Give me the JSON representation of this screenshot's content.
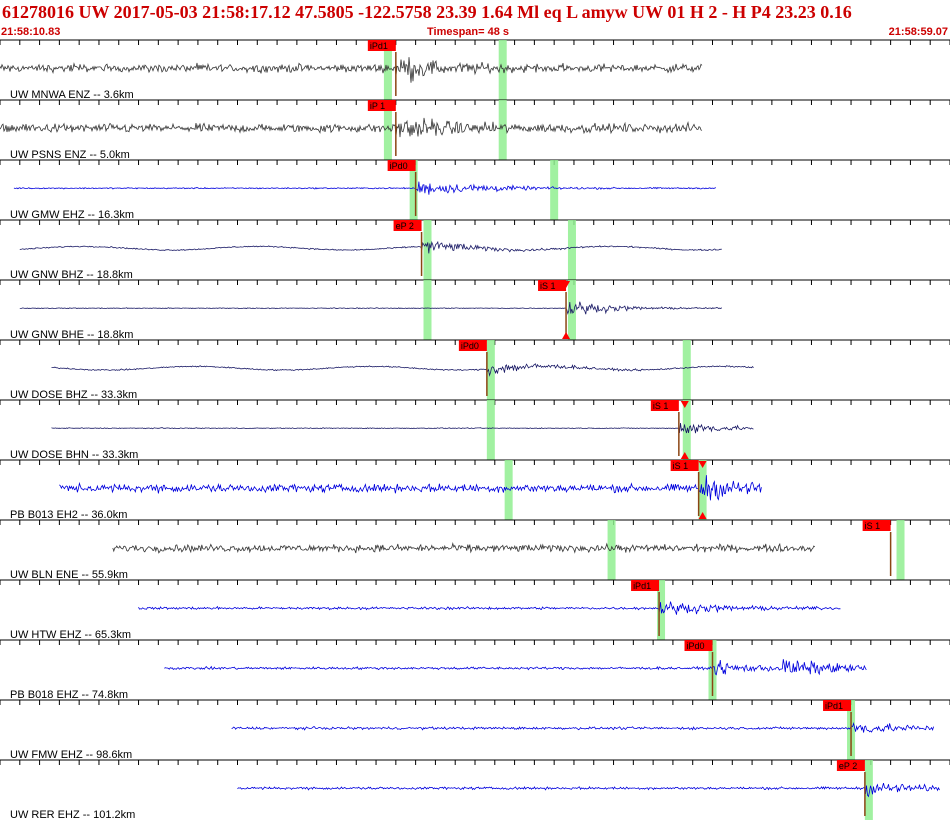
{
  "header": {
    "title": "61278016 UW 2017-05-03 21:58:17.12   47.5805 -122.5758  23.39  1.64 Ml  eq  L amyw     UW 01  H   2  - H P4   23.23  0.16",
    "start_time": "21:58:10.83",
    "timespan": "Timespan=  48 s",
    "end_time": "21:58:59.07"
  },
  "colors": {
    "background": "#ffffff",
    "title_text": "#cc0000",
    "trace_gray": "#333333",
    "trace_blue": "#0000dd",
    "trace_navy": "#1a1a66",
    "pick_flag": "#ff0000",
    "pick_line": "#8b4513",
    "predicted_marker": "#90ee90",
    "arrival_triangle": "#ff0000"
  },
  "chart_data": {
    "type": "line",
    "title": "",
    "xlabel": "",
    "ylabel": "",
    "x_unit": "s",
    "xlim": [
      0,
      48
    ],
    "tick_interval_s": 1,
    "grid": false,
    "legend": "none",
    "series": [
      {
        "label": "UW MNWA ENZ -- 3.6km",
        "color": "gray",
        "style": "noisy",
        "amp": 0.55,
        "data_start_s": 0.0,
        "data_end_s": 35.5,
        "picks": [
          {
            "label": "iPd1",
            "time_s": 20.0
          }
        ],
        "predicted": [
          19.6,
          25.4
        ],
        "triangles": []
      },
      {
        "label": "UW PSNS ENZ -- 5.0km",
        "color": "gray",
        "style": "noisy",
        "amp": 0.6,
        "data_start_s": 0.0,
        "data_end_s": 35.5,
        "picks": [
          {
            "label": "iP 1",
            "time_s": 20.0
          }
        ],
        "predicted": [
          19.6,
          25.4
        ],
        "triangles": []
      },
      {
        "label": "UW GMW EHZ -- 16.3km",
        "color": "blue",
        "style": "quiet",
        "amp": 0.35,
        "data_start_s": 0.7,
        "data_end_s": 36.2,
        "picks": [
          {
            "label": "iPd0",
            "time_s": 21.0
          }
        ],
        "predicted": [
          20.9,
          28.0
        ],
        "triangles": []
      },
      {
        "label": "UW GNW BHZ -- 18.8km",
        "color": "navy",
        "style": "wavy",
        "amp": 0.3,
        "data_start_s": 1.0,
        "data_end_s": 36.5,
        "picks": [
          {
            "label": "eP 2",
            "time_s": 21.3
          }
        ],
        "predicted": [
          21.6,
          28.9
        ],
        "triangles": []
      },
      {
        "label": "UW GNW BHE -- 18.8km",
        "color": "navy",
        "style": "flat",
        "amp": 0.45,
        "data_start_s": 1.0,
        "data_end_s": 36.5,
        "picks": [
          {
            "label": "iS 1",
            "time_s": 28.6
          }
        ],
        "predicted": [
          21.6,
          28.9
        ],
        "triangles": [
          28.6
        ]
      },
      {
        "label": "UW DOSE BHZ -- 33.3km",
        "color": "navy",
        "style": "wavy",
        "amp": 0.3,
        "data_start_s": 2.6,
        "data_end_s": 38.1,
        "picks": [
          {
            "label": "iPd0",
            "time_s": 24.6
          }
        ],
        "predicted": [
          24.8,
          34.7
        ],
        "triangles": []
      },
      {
        "label": "UW DOSE BHN -- 33.3km",
        "color": "navy",
        "style": "flat",
        "amp": 0.45,
        "data_start_s": 2.6,
        "data_end_s": 38.1,
        "picks": [
          {
            "label": "iS 1",
            "time_s": 34.3
          }
        ],
        "predicted": [
          24.8,
          34.7
        ],
        "triangles": [
          34.6
        ]
      },
      {
        "label": "PB B013 EH2 -- 36.0km",
        "color": "blue",
        "style": "noisy",
        "amp": 0.55,
        "data_start_s": 3.0,
        "data_end_s": 38.5,
        "picks": [
          {
            "label": "iS 1",
            "time_s": 35.3
          }
        ],
        "predicted": [
          25.7,
          35.5
        ],
        "triangles": [
          35.5
        ]
      },
      {
        "label": "UW BLN ENE -- 55.9km",
        "color": "gray",
        "style": "noisy",
        "amp": 0.5,
        "data_start_s": 5.7,
        "data_end_s": 41.2,
        "picks": [
          {
            "label": "iS 1",
            "time_s": 45.0
          }
        ],
        "predicted": [
          30.9,
          45.5
        ],
        "triangles": []
      },
      {
        "label": "UW HTW EHZ -- 65.3km",
        "color": "blue",
        "style": "event",
        "amp": 0.4,
        "data_start_s": 7.0,
        "data_end_s": 42.5,
        "picks": [
          {
            "label": "iPd1",
            "time_s": 33.3
          }
        ],
        "predicted": [
          33.4,
          49.9
        ],
        "triangles": [
          49.8
        ]
      },
      {
        "label": "PB B018 EHZ -- 74.8km",
        "color": "blue",
        "style": "event",
        "amp": 0.35,
        "data_start_s": 8.3,
        "data_end_s": 43.8,
        "picks": [
          {
            "label": "iPd0",
            "time_s": 36.0
          }
        ],
        "predicted": [
          36.0,
          55.0
        ],
        "triangles": []
      },
      {
        "label": "UW FMW EHZ -- 98.6km",
        "color": "blue",
        "style": "event",
        "amp": 0.4,
        "data_start_s": 11.7,
        "data_end_s": 47.2,
        "picks": [
          {
            "label": "iPd1",
            "time_s": 43.0
          }
        ],
        "predicted": [
          43.0,
          67.0
        ],
        "triangles": [
          67.0
        ]
      },
      {
        "label": "UW RER EHZ -- 101.2km",
        "color": "blue",
        "style": "event",
        "amp": 0.4,
        "data_start_s": 12.0,
        "data_end_s": 47.5,
        "picks": [
          {
            "label": "eP 2",
            "time_s": 43.7
          }
        ],
        "predicted": [
          43.9,
          68.0
        ],
        "triangles": [
          68.0
        ]
      }
    ]
  }
}
